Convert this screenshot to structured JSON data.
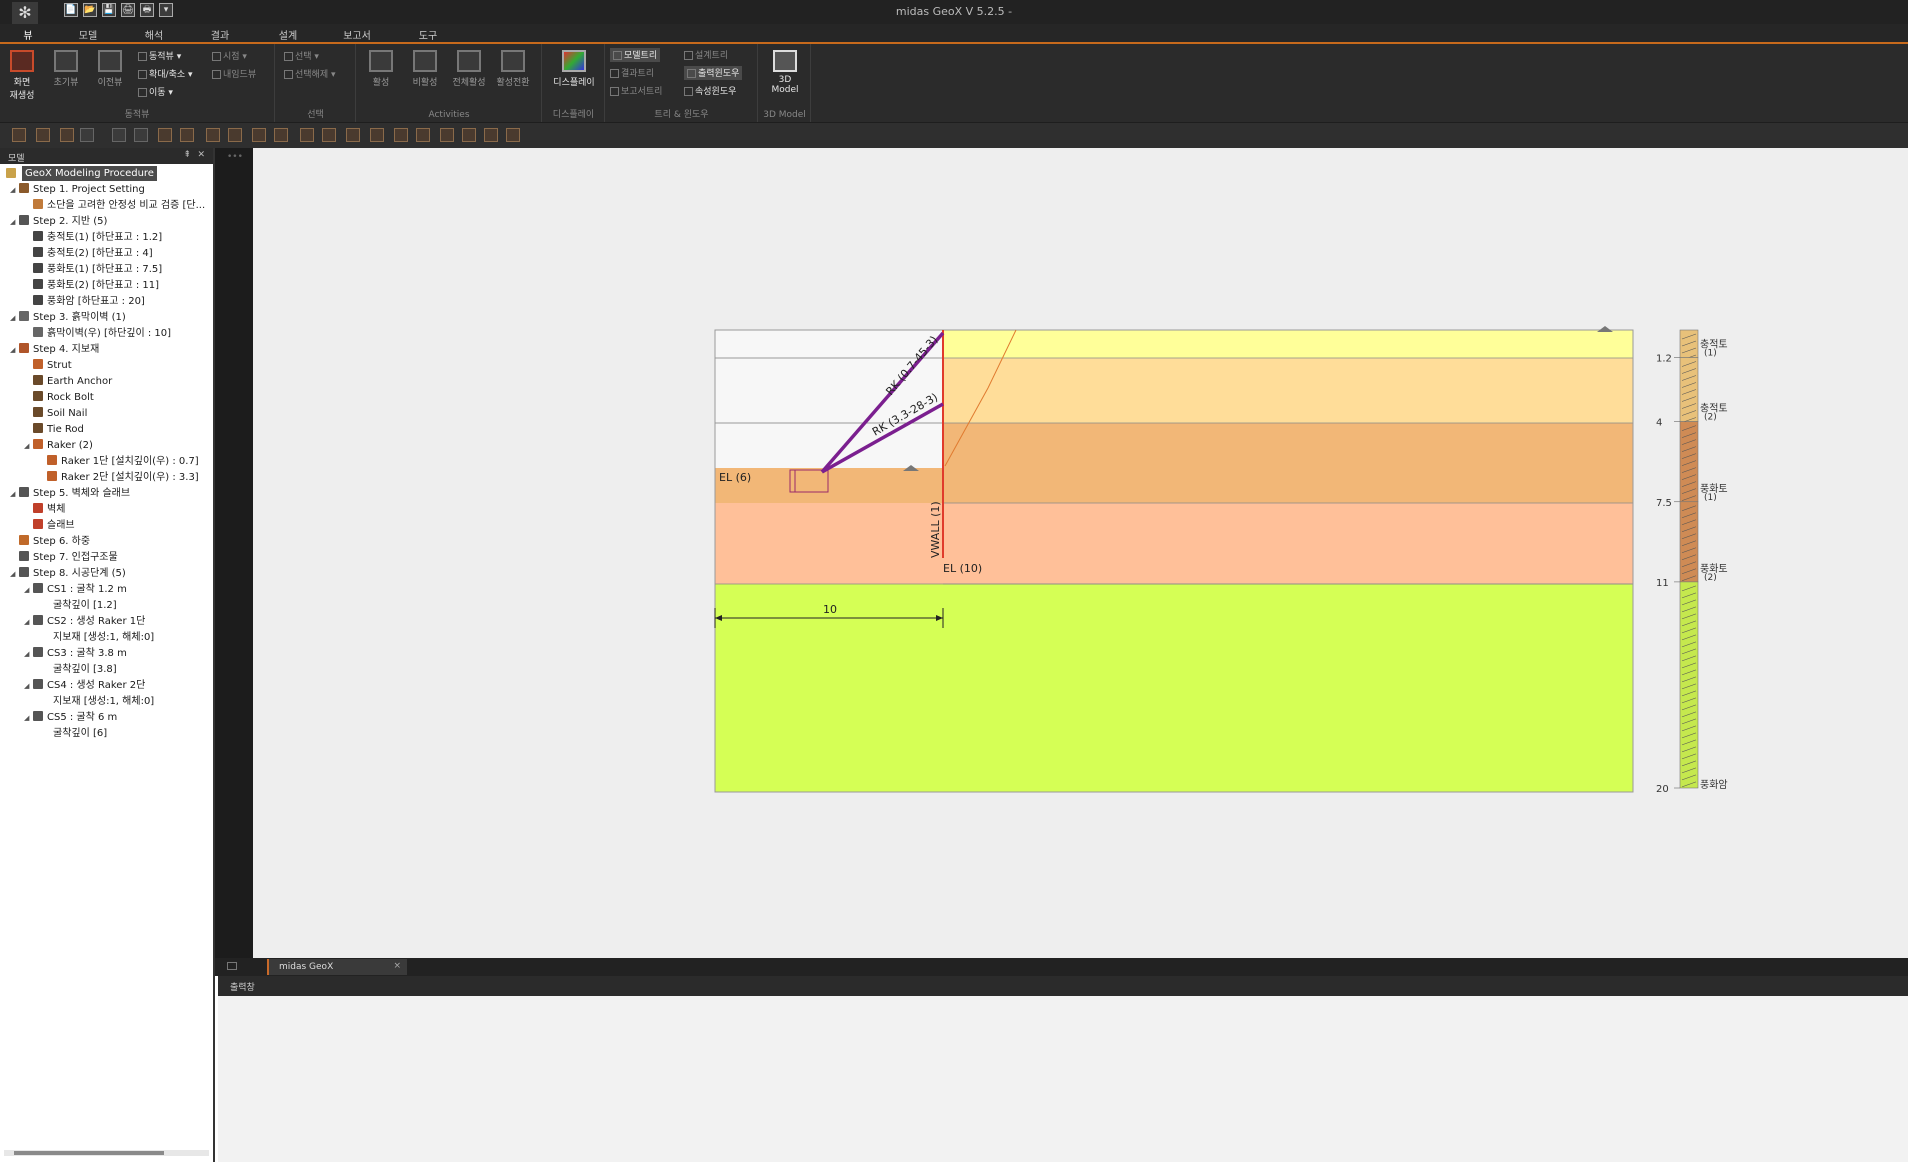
{
  "titlebar": {
    "logo": "✻",
    "window_title": "midas GeoX V 5.2.5 -",
    "qat": [
      "📄",
      "📂",
      "💾",
      "🖨",
      "🖶",
      "▾"
    ]
  },
  "menu": {
    "items": [
      "뷰",
      "모델",
      "해석",
      "결과",
      "설계",
      "보고서",
      "도구"
    ]
  },
  "ribbon": {
    "groups": {
      "view": {
        "label": "동적뷰",
        "big": [
          "화면\n재생성",
          "초기뷰",
          "이전뷰"
        ],
        "small": [
          "동적뷰 ▾",
          "확대/축소 ▾",
          "이동 ▾"
        ]
      },
      "select": {
        "label": "선택",
        "small": [
          "시점 ▾",
          "내임드뷰",
          "선택 ▾",
          "선택해제 ▾"
        ]
      },
      "activities": {
        "label": "Activities",
        "big": [
          "활성",
          "비활성",
          "전체활성",
          "활성전환"
        ]
      },
      "display": {
        "label": "디스플레이",
        "big": [
          "디스플레이"
        ]
      },
      "tree": {
        "label": "트리 & 윈도우",
        "small": [
          "모델트리",
          "결과트리",
          "보고서트리",
          "설계트리",
          "출력윈도우",
          "속성윈도우"
        ]
      },
      "model3d": {
        "label": "3D Model",
        "big": [
          "3D\nModel"
        ]
      }
    }
  },
  "left_panel": {
    "title": "모델",
    "pin": "⇞",
    "close": "✕",
    "root": "GeoX Modeling Procedure",
    "rows": [
      {
        "t": "Step 1. Project Setting",
        "lvl": 0,
        "tw": "◢",
        "ic": "#8b5a2b"
      },
      {
        "t": "소단을 고려한 안정성 비교 검증 [단...",
        "lvl": 1,
        "tw": "",
        "ic": "#c07a3a"
      },
      {
        "t": "Step 2. 지반 (5)",
        "lvl": 0,
        "tw": "◢",
        "ic": "#555"
      },
      {
        "t": "충적토(1) [하단표고 : 1.2]",
        "lvl": 1,
        "tw": "",
        "ic": "#444"
      },
      {
        "t": "충적토(2) [하단표고 : 4]",
        "lvl": 1,
        "tw": "",
        "ic": "#444"
      },
      {
        "t": "풍화토(1) [하단표고 : 7.5]",
        "lvl": 1,
        "tw": "",
        "ic": "#444"
      },
      {
        "t": "풍화토(2) [하단표고 : 11]",
        "lvl": 1,
        "tw": "",
        "ic": "#444"
      },
      {
        "t": "풍화암 [하단표고 : 20]",
        "lvl": 1,
        "tw": "",
        "ic": "#444"
      },
      {
        "t": "Step 3. 흙막이벽 (1)",
        "lvl": 0,
        "tw": "◢",
        "ic": "#666"
      },
      {
        "t": "흙막이벽(우) [하단깊이 : 10]",
        "lvl": 1,
        "tw": "",
        "ic": "#666"
      },
      {
        "t": "Step 4. 지보재",
        "lvl": 0,
        "tw": "◢",
        "ic": "#b0552a"
      },
      {
        "t": "Strut",
        "lvl": 1,
        "tw": "",
        "ic": "#c0602a"
      },
      {
        "t": "Earth Anchor",
        "lvl": 1,
        "tw": "",
        "ic": "#6a4a2a"
      },
      {
        "t": "Rock Bolt",
        "lvl": 1,
        "tw": "",
        "ic": "#6a4a2a"
      },
      {
        "t": "Soil Nail",
        "lvl": 1,
        "tw": "",
        "ic": "#6a4a2a"
      },
      {
        "t": "Tie Rod",
        "lvl": 1,
        "tw": "",
        "ic": "#6a4a2a"
      },
      {
        "t": "Raker (2)",
        "lvl": 1,
        "tw": "◢",
        "ic": "#c0602a"
      },
      {
        "t": "Raker 1단 [설치깊이(우) : 0.7]",
        "lvl": 2,
        "tw": "",
        "ic": "#c0602a"
      },
      {
        "t": "Raker 2단 [설치깊이(우) : 3.3]",
        "lvl": 2,
        "tw": "",
        "ic": "#c0602a"
      },
      {
        "t": "Step 5. 벽체와 슬래브",
        "lvl": 0,
        "tw": "◢",
        "ic": "#555"
      },
      {
        "t": "벽체",
        "lvl": 1,
        "tw": "",
        "ic": "#c0402a"
      },
      {
        "t": "슬래브",
        "lvl": 1,
        "tw": "",
        "ic": "#c0402a"
      },
      {
        "t": "Step 6. 하중",
        "lvl": 0,
        "tw": "",
        "ic": "#c06a2a"
      },
      {
        "t": "Step 7. 인접구조물",
        "lvl": 0,
        "tw": "",
        "ic": "#555"
      },
      {
        "t": "Step 8. 시공단계 (5)",
        "lvl": 0,
        "tw": "◢",
        "ic": "#555"
      },
      {
        "t": "CS1 : 굴착 1.2 m",
        "lvl": 1,
        "tw": "◢",
        "ic": "#555"
      },
      {
        "t": "굴착깊이 [1.2]",
        "lvl": 2,
        "tw": "",
        "ic": ""
      },
      {
        "t": "CS2 : 생성 Raker 1단",
        "lvl": 1,
        "tw": "◢",
        "ic": "#555"
      },
      {
        "t": "지보재 [생성:1, 해체:0]",
        "lvl": 2,
        "tw": "",
        "ic": ""
      },
      {
        "t": "CS3 : 굴착 3.8 m",
        "lvl": 1,
        "tw": "◢",
        "ic": "#555"
      },
      {
        "t": "굴착깊이 [3.8]",
        "lvl": 2,
        "tw": "",
        "ic": ""
      },
      {
        "t": "CS4 : 생성 Raker 2단",
        "lvl": 1,
        "tw": "◢",
        "ic": "#555"
      },
      {
        "t": "지보재 [생성:1, 해체:0]",
        "lvl": 2,
        "tw": "",
        "ic": ""
      },
      {
        "t": "CS5 : 굴착 6 m",
        "lvl": 1,
        "tw": "◢",
        "ic": "#555"
      },
      {
        "t": "굴착깊이 [6]",
        "lvl": 2,
        "tw": "",
        "ic": ""
      }
    ]
  },
  "splitter": {
    "dots": "•••"
  },
  "canvas": {
    "layers": [
      {
        "color": "#ffff99"
      },
      {
        "color": "#ffdd99"
      },
      {
        "color": "#f2b777"
      },
      {
        "color": "#ffc099"
      },
      {
        "color": "#d5ff55"
      }
    ],
    "labels": {
      "el_left": "EL (6)",
      "el_right": "EL (10)",
      "wall": "VWALL (1)",
      "raker1": "RK (0.7-45-3)",
      "raker2": "RK (3.3-28-3)",
      "dim": "10"
    },
    "boring": {
      "depths": [
        "1.2",
        "4",
        "7.5",
        "11",
        "20"
      ],
      "names": [
        [
          "충적토",
          "(1)"
        ],
        [
          "충적토",
          "(2)"
        ],
        [
          "풍화토",
          "(1)"
        ],
        [
          "풍화토",
          "(2)"
        ],
        [
          "풍화암",
          ""
        ]
      ]
    }
  },
  "doc_tabs": {
    "tab": "midas GeoX",
    "close": "×",
    "arrow": "◂"
  },
  "output": {
    "title": "출력창"
  }
}
